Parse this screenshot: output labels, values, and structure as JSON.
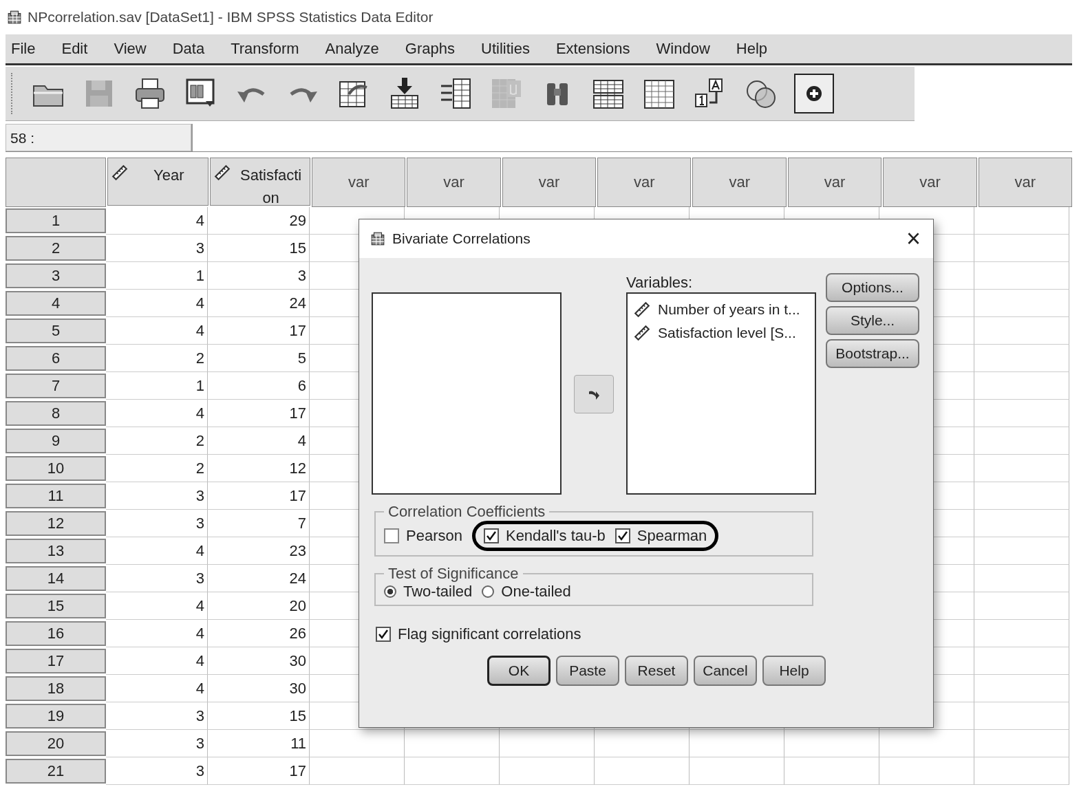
{
  "window": {
    "title": "NPcorrelation.sav [DataSet1] - IBM SPSS Statistics Data Editor"
  },
  "menu": [
    "File",
    "Edit",
    "View",
    "Data",
    "Transform",
    "Analyze",
    "Graphs",
    "Utilities",
    "Extensions",
    "Window",
    "Help"
  ],
  "toolbar": [
    {
      "kind": "open",
      "disabled": false
    },
    {
      "kind": "save",
      "disabled": true
    },
    {
      "kind": "print",
      "disabled": false
    },
    {
      "kind": "dialog",
      "disabled": false
    },
    {
      "kind": "undo",
      "disabled": false
    },
    {
      "kind": "redo",
      "disabled": false
    },
    {
      "kind": "goto",
      "disabled": false
    },
    {
      "kind": "import",
      "disabled": false
    },
    {
      "kind": "list",
      "disabled": false
    },
    {
      "kind": "mu",
      "disabled": true
    },
    {
      "kind": "find",
      "disabled": false
    },
    {
      "kind": "split",
      "disabled": false
    },
    {
      "kind": "grid",
      "disabled": false
    },
    {
      "kind": "labels",
      "disabled": false
    },
    {
      "kind": "circles",
      "disabled": false
    },
    {
      "kind": "add",
      "disabled": false
    }
  ],
  "cell_editor": {
    "cell": "58 :"
  },
  "grid": {
    "columns": [
      {
        "label": "Year",
        "kind": "variable"
      },
      {
        "label": "Satisfaction",
        "kind": "variable"
      },
      {
        "label": "var",
        "kind": "empty"
      },
      {
        "label": "var",
        "kind": "empty"
      },
      {
        "label": "var",
        "kind": "empty"
      },
      {
        "label": "var",
        "kind": "empty"
      },
      {
        "label": "var",
        "kind": "empty"
      },
      {
        "label": "var",
        "kind": "empty"
      },
      {
        "label": "var",
        "kind": "empty"
      },
      {
        "label": "var",
        "kind": "empty"
      }
    ],
    "rows": [
      {
        "number": "1",
        "cells": [
          "4",
          "29"
        ]
      },
      {
        "number": "2",
        "cells": [
          "3",
          "15"
        ]
      },
      {
        "number": "3",
        "cells": [
          "1",
          "3"
        ]
      },
      {
        "number": "4",
        "cells": [
          "4",
          "24"
        ]
      },
      {
        "number": "5",
        "cells": [
          "4",
          "17"
        ]
      },
      {
        "number": "6",
        "cells": [
          "2",
          "5"
        ]
      },
      {
        "number": "7",
        "cells": [
          "1",
          "6"
        ]
      },
      {
        "number": "8",
        "cells": [
          "4",
          "17"
        ]
      },
      {
        "number": "9",
        "cells": [
          "2",
          "4"
        ]
      },
      {
        "number": "10",
        "cells": [
          "2",
          "12"
        ]
      },
      {
        "number": "11",
        "cells": [
          "3",
          "17"
        ]
      },
      {
        "number": "12",
        "cells": [
          "3",
          "7"
        ]
      },
      {
        "number": "13",
        "cells": [
          "4",
          "23"
        ]
      },
      {
        "number": "14",
        "cells": [
          "3",
          "24"
        ]
      },
      {
        "number": "15",
        "cells": [
          "4",
          "20"
        ]
      },
      {
        "number": "16",
        "cells": [
          "4",
          "26"
        ]
      },
      {
        "number": "17",
        "cells": [
          "4",
          "30"
        ]
      },
      {
        "number": "18",
        "cells": [
          "4",
          "30"
        ]
      },
      {
        "number": "19",
        "cells": [
          "3",
          "15"
        ]
      },
      {
        "number": "20",
        "cells": [
          "3",
          "11"
        ]
      },
      {
        "number": "21",
        "cells": [
          "3",
          "17"
        ]
      }
    ]
  },
  "dialog": {
    "title": "Bivariate Correlations",
    "close": "×",
    "variables_label": "Variables:",
    "variables": [
      "Number of years in t...",
      "Satisfaction level [S..."
    ],
    "side_buttons": [
      "Options...",
      "Style...",
      "Bootstrap..."
    ],
    "coefficients": {
      "title": "Correlation Coefficients",
      "options": [
        {
          "label": "Pearson",
          "checked": false,
          "highlighted": false
        },
        {
          "label": "Kendall's tau-b",
          "checked": true,
          "highlighted": true
        },
        {
          "label": "Spearman",
          "checked": true,
          "highlighted": true
        }
      ]
    },
    "significance": {
      "title": "Test of Significance",
      "options": [
        {
          "label": "Two-tailed",
          "selected": true
        },
        {
          "label": "One-tailed",
          "selected": false
        }
      ]
    },
    "flag": {
      "label": "Flag significant correlations",
      "checked": true
    },
    "buttons": [
      {
        "label": "OK",
        "default": true
      },
      {
        "label": "Paste",
        "default": false
      },
      {
        "label": "Reset",
        "default": false
      },
      {
        "label": "Cancel",
        "default": false
      },
      {
        "label": "Help",
        "default": false
      }
    ]
  }
}
